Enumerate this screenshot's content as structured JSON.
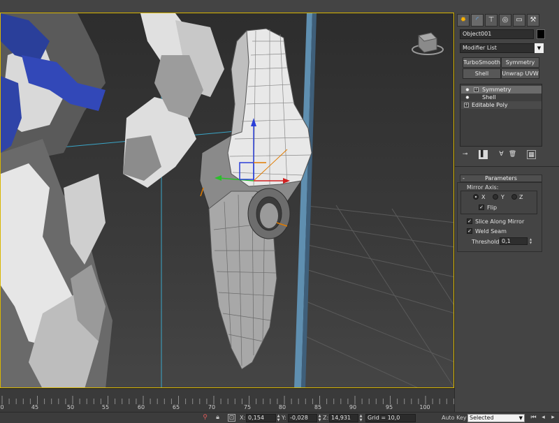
{
  "viewport": {
    "view_cube": "view-cube-icon",
    "frame_color": "#d9b600"
  },
  "timeline": {
    "ticks": [
      "0",
      "5",
      "10",
      "15",
      "20",
      "25",
      "30",
      "35",
      "40",
      "45",
      "50",
      "55",
      "60",
      "65",
      "70",
      "75",
      "80",
      "85",
      "90",
      "95",
      "100"
    ],
    "visible_tick_labels": [
      "0",
      "45",
      "50",
      "55",
      "60",
      "65",
      "70",
      "75",
      "80",
      "85",
      "90",
      "95",
      "100"
    ]
  },
  "statusbar": {
    "x_label": "X:",
    "x_value": "0,154",
    "y_label": "Y:",
    "y_value": "-0,028",
    "z_label": "Z:",
    "z_value": "14,931",
    "grid": "Grid = 10,0",
    "auto_key": "Auto Key",
    "selected": "Selected"
  },
  "panel": {
    "tabs": [
      "create-icon",
      "modify-icon",
      "hierarchy-icon",
      "motion-icon",
      "display-icon",
      "utilities-icon"
    ],
    "object_name": "Object001",
    "object_color": "#000000",
    "modifier_list": "Modifier List",
    "modifier_buttons": {
      "turbosmooth": "TurboSmooth",
      "symmetry": "Symmetry",
      "shell": "Shell",
      "unwrap": "Unwrap UVW"
    },
    "stack": {
      "items": [
        {
          "label": "Symmetry",
          "selected": true
        },
        {
          "label": "Shell",
          "selected": false
        },
        {
          "label": "Editable Poly",
          "selected": false
        }
      ]
    },
    "parameters": {
      "title": "Parameters",
      "mirror_axis_label": "Mirror Axis:",
      "axis_x": "X",
      "axis_y": "Y",
      "axis_z": "Z",
      "selected_axis": "X",
      "flip_label": "Flip",
      "flip_checked": true,
      "slice_label": "Slice Along Mirror",
      "slice_checked": true,
      "weld_label": "Weld Seam",
      "weld_checked": true,
      "threshold_label": "Threshold:",
      "threshold_value": "0,1"
    }
  }
}
